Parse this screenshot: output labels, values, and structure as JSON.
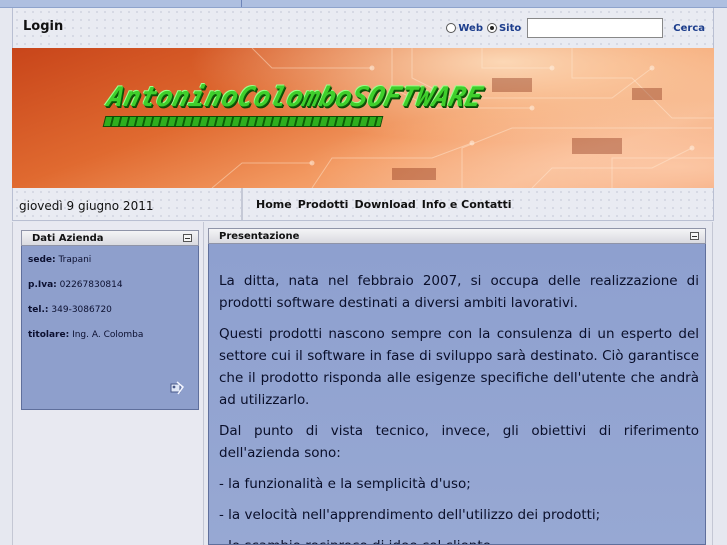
{
  "header": {
    "login_label": "Login",
    "search": {
      "options": [
        {
          "label": "Web",
          "checked": false
        },
        {
          "label": "Sito",
          "checked": true
        }
      ],
      "query": "",
      "button_label": "Cerca"
    }
  },
  "banner": {
    "logo_text": "AntoninoColomboSOFTWARE"
  },
  "nav": {
    "date": "giovedì 9 giugno 2011",
    "items": [
      "Home",
      "Prodotti",
      "Download",
      "Info e Contatti"
    ]
  },
  "sidebar": {
    "panel_title": "Dati Azienda",
    "fields": [
      {
        "label": "sede:",
        "value": "Trapani"
      },
      {
        "label": "p.Iva:",
        "value": "02267830814"
      },
      {
        "label": "tel.:",
        "value": "349-3086720"
      },
      {
        "label": "titolare:",
        "value": "Ing. A. Colomba"
      }
    ]
  },
  "main": {
    "panel_title": "Presentazione",
    "paragraphs": [
      "La ditta, nata nel febbraio 2007, si occupa delle realizzazione di prodotti software destinati a diversi ambiti lavorativi.",
      "Questi prodotti nascono sempre con la consulenza di un esperto del settore cui il software in fase di sviluppo sarà destinato.  Ciò garantisce che il prodotto risponda alle esigenze specifiche dell'utente che andrà ad utilizzarlo.",
      "Dal punto di vista tecnico, invece, gli obiettivi di riferimento dell'azienda sono:",
      "- la funzionalità e la semplicità d'uso;",
      "- la velocità nell'apprendimento dell'utilizzo dei prodotti;",
      "- lo scambio reciproco di idee col cliente."
    ]
  }
}
